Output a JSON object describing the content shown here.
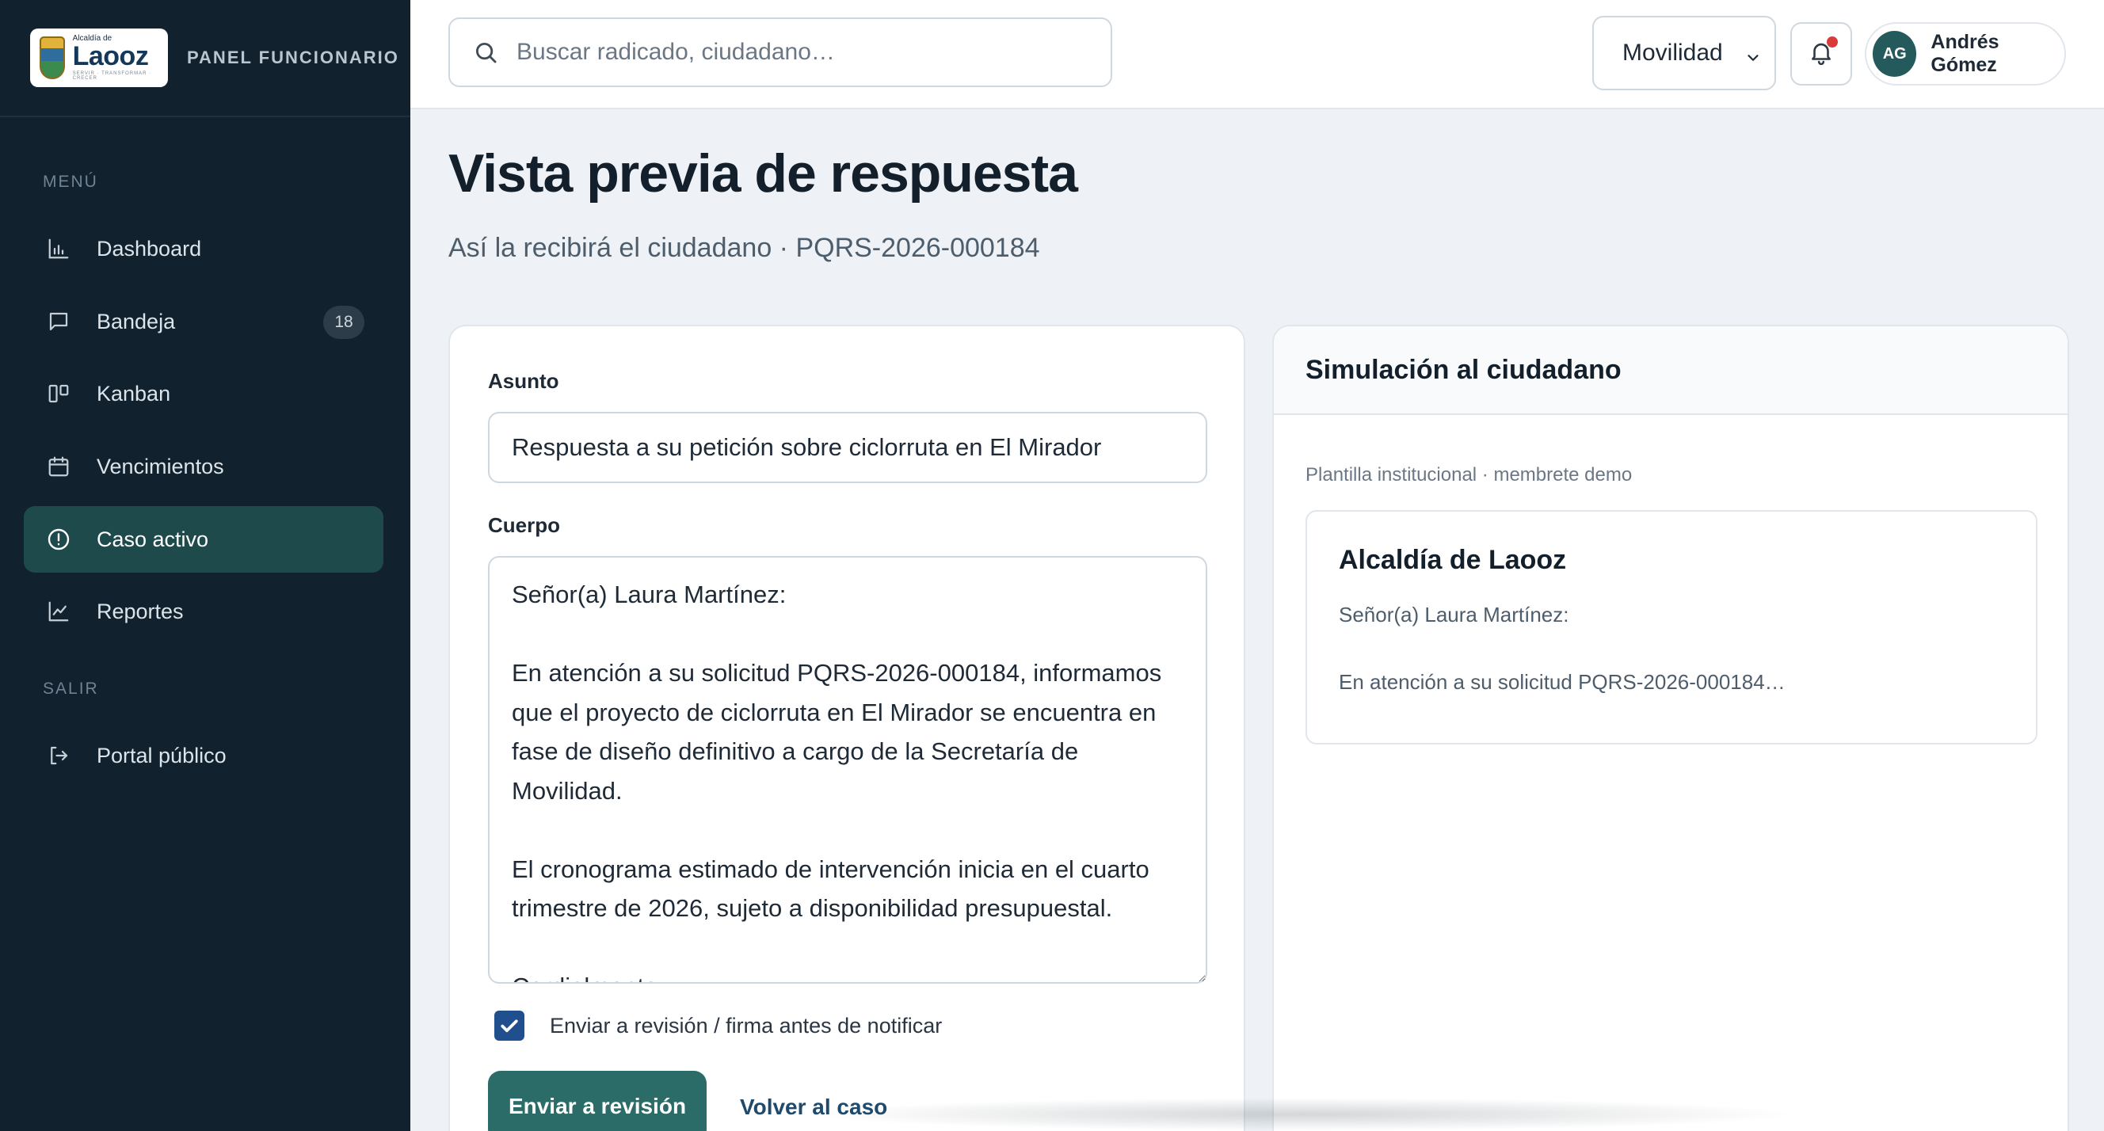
{
  "brand": {
    "logo_small": "Alcaldía de",
    "logo_name": "Laooz",
    "logo_tag": "SERVIR · TRANSFORMAR · CRECER",
    "panel_caption": "PANEL FUNCIONARIO"
  },
  "sidebar": {
    "menu_heading": "MENÚ",
    "items": [
      {
        "label": "Dashboard",
        "icon": "bar-chart-icon"
      },
      {
        "label": "Bandeja",
        "icon": "inbox-icon",
        "badge": "18"
      },
      {
        "label": "Kanban",
        "icon": "kanban-icon"
      },
      {
        "label": "Vencimientos",
        "icon": "calendar-icon"
      },
      {
        "label": "Caso activo",
        "icon": "alert-circle-icon",
        "active": true
      },
      {
        "label": "Reportes",
        "icon": "line-chart-icon"
      }
    ],
    "exit_heading": "SALIR",
    "exit_items": [
      {
        "label": "Portal público",
        "icon": "logout-icon"
      }
    ]
  },
  "topbar": {
    "search_placeholder": "Buscar radicado, ciudadano…",
    "department": "Movilidad",
    "user_initials": "AG",
    "user_name": "Andrés Gómez",
    "notification_dot_color": "#d93b3b"
  },
  "page": {
    "title": "Vista previa de respuesta",
    "subtitle": "Así la recibirá el ciudadano · PQRS-2026-000184"
  },
  "editor": {
    "subject_label": "Asunto",
    "subject_value": "Respuesta a su petición sobre ciclorruta en El Mirador",
    "body_label": "Cuerpo",
    "body_value": "Señor(a) Laura Martínez:\n\nEn atención a su solicitud PQRS-2026-000184, informamos que el proyecto de ciclorruta en El Mirador se encuentra en fase de diseño definitivo a cargo de la Secretaría de Movilidad.\n\nEl cronograma estimado de intervención inicia en el cuarto trimestre de 2026, sujeto a disponibilidad presupuestal.\n\nCordialmente,\nSecretaría de Movilidad",
    "review_checkbox_label": "Enviar a revisión / firma antes de notificar",
    "review_checked": true,
    "primary_button": "Enviar a revisión",
    "secondary_link": "Volver al caso"
  },
  "simulation": {
    "title": "Simulación al ciudadano",
    "template_meta": "Plantilla institucional · membrete demo",
    "letter_org": "Alcaldía de Laooz",
    "letter_greeting": "Señor(a) Laura Martínez:",
    "letter_snippet": "En atención a su solicitud PQRS-2026-000184…"
  },
  "colors": {
    "sidebar_bg": "#11212d",
    "active_item_bg": "#1f4a4c",
    "primary_button": "#2b6b68",
    "checkbox": "#1f4f8c"
  }
}
